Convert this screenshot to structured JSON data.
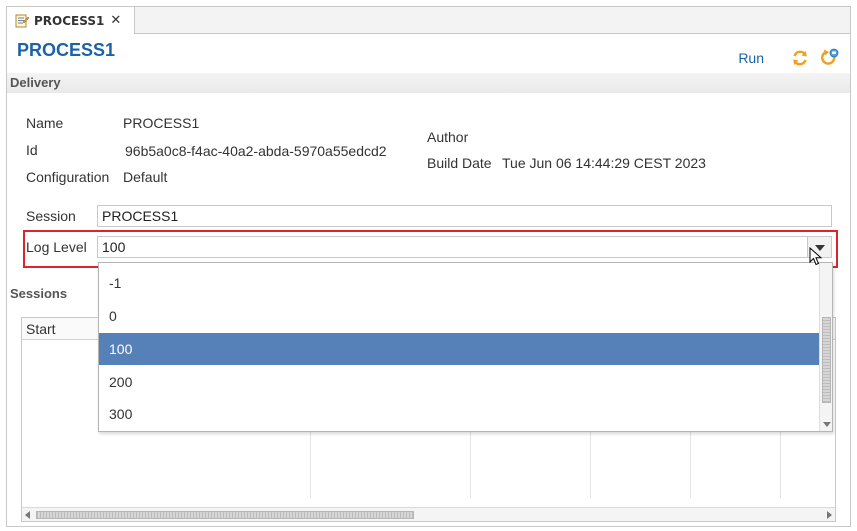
{
  "tab": {
    "label": "PROCESS1",
    "close_glyph": "✕",
    "icon": "process-document-icon"
  },
  "header": {
    "title": "PROCESS1",
    "run_label": "Run",
    "icons": [
      "refresh-icon",
      "session-icon"
    ]
  },
  "delivery": {
    "section_label": "Delivery",
    "name_label": "Name",
    "name_value": "PROCESS1",
    "id_label": "Id",
    "id_value": "96b5a0c8-f4ac-40a2-abda-5970a55edcd2",
    "configuration_label": "Configuration",
    "configuration_value": "Default",
    "author_label": "Author",
    "author_value": "",
    "build_date_label": "Build Date",
    "build_date_value": "Tue Jun 06 14:44:29 CEST 2023",
    "session_label": "Session",
    "session_value": "PROCESS1",
    "log_level_label": "Log Level",
    "log_level_value": "100"
  },
  "log_level_options": [
    "-1",
    "0",
    "100",
    "200",
    "300"
  ],
  "selected_option": "100",
  "sessions": {
    "section_label": "Sessions",
    "columns": [
      "Start"
    ]
  },
  "colors": {
    "accent": "#1b63a8",
    "selection": "#5580b8",
    "highlight_border": "#d9262d"
  }
}
